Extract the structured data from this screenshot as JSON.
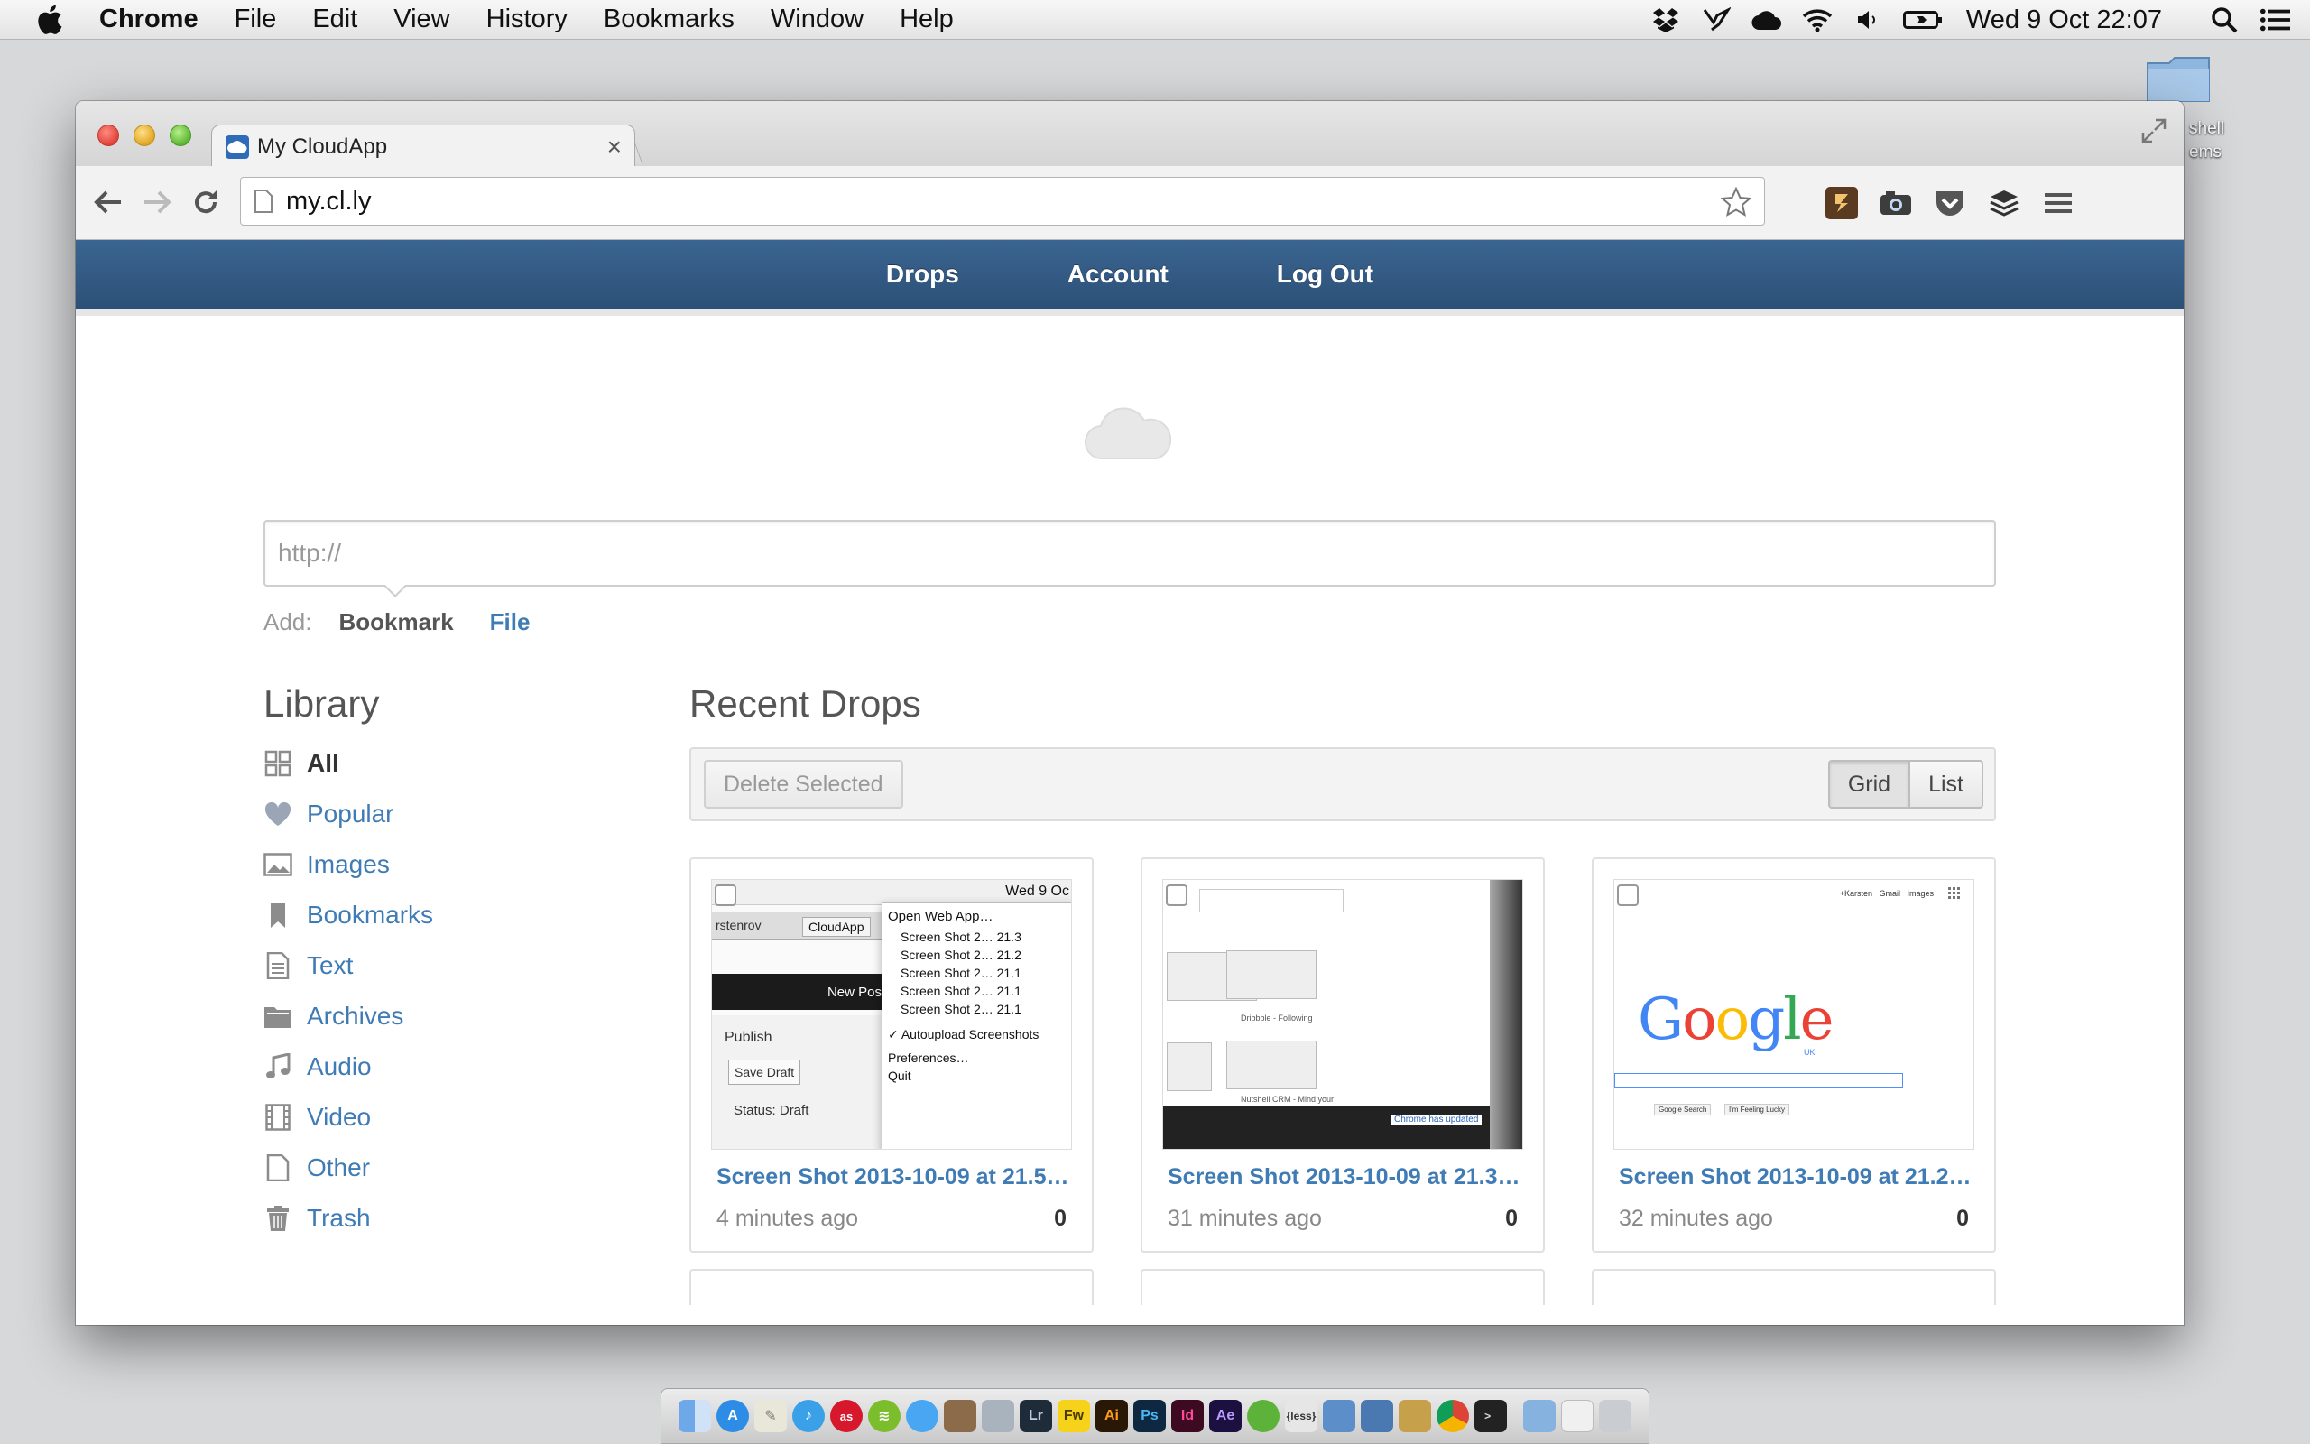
{
  "menubar": {
    "app_name": "Chrome",
    "items": [
      "File",
      "Edit",
      "View",
      "History",
      "Bookmarks",
      "Window",
      "Help"
    ],
    "clock": "Wed 9 Oct  22:07",
    "status_icons": [
      "dropbox-icon",
      "crane-icon",
      "cloud-icon",
      "wifi-icon",
      "volume-icon",
      "battery-icon",
      "spotlight-icon",
      "notification-center-icon"
    ]
  },
  "desktop": {
    "folder_label_line1": "shell",
    "folder_label_line2": "ems"
  },
  "browser": {
    "tab_title": "My CloudApp",
    "url": "my.cl.ly",
    "extensions": [
      "zootool-icon",
      "camera-icon",
      "pocket-icon",
      "buffer-icon",
      "menu-icon"
    ]
  },
  "site_nav": {
    "drops": "Drops",
    "account": "Account",
    "logout": "Log Out"
  },
  "add_form": {
    "placeholder": "http://",
    "add_label": "Add:",
    "bookmark_label": "Bookmark",
    "file_label": "File"
  },
  "library": {
    "title": "Library",
    "items": [
      {
        "label": "All",
        "icon": "grid-icon",
        "active": true
      },
      {
        "label": "Popular",
        "icon": "heart-icon"
      },
      {
        "label": "Images",
        "icon": "image-icon"
      },
      {
        "label": "Bookmarks",
        "icon": "bookmark-icon"
      },
      {
        "label": "Text",
        "icon": "text-file-icon"
      },
      {
        "label": "Archives",
        "icon": "archive-icon"
      },
      {
        "label": "Audio",
        "icon": "music-note-icon"
      },
      {
        "label": "Video",
        "icon": "film-icon"
      },
      {
        "label": "Other",
        "icon": "blank-file-icon"
      },
      {
        "label": "Trash",
        "icon": "trash-icon"
      }
    ]
  },
  "drops": {
    "title": "Recent Drops",
    "delete_label": "Delete Selected",
    "grid_label": "Grid",
    "list_label": "List",
    "items": [
      {
        "name": "Screen Shot 2013-10-09 at 21.5…",
        "time": "4 minutes ago",
        "views": "0"
      },
      {
        "name": "Screen Shot 2013-10-09 at 21.3…",
        "time": "31 minutes ago",
        "views": "0"
      },
      {
        "name": "Screen Shot 2013-10-09 at 21.2…",
        "time": "32 minutes ago",
        "views": "0"
      }
    ],
    "thumb1": {
      "status_date": "Wed 9 Oc",
      "tab_label": "CloudApp",
      "tab_prefix": "rstenrov",
      "new_post": "New Pos",
      "publish": "Publish",
      "save_draft": "Save Draft",
      "status_draft": "Status: Draft",
      "menu": [
        "Open Web App…",
        "Screen Shot 2… 21.3",
        "Screen Shot 2… 21.2",
        "Screen Shot 2… 21.1",
        "Screen Shot 2… 21.1",
        "Screen Shot 2… 21.1",
        "✓ Autoupload Screenshots",
        "Preferences…",
        "Quit"
      ]
    },
    "thumb2": {
      "caption1": "Dribbble - Following",
      "caption2": "Nutshell CRM - Mind your",
      "caption3": "Chrome has updated"
    },
    "thumb3": {
      "logo": "Google",
      "logo_sub": "UK",
      "top_links": "+Karsten   Gmail   Images",
      "search_btn": "Google Search",
      "lucky_btn": "I'm Feeling Lucky"
    }
  },
  "dock": {
    "icons": [
      "finder-icon",
      "app-store-icon",
      "preview-icon",
      "itunes-icon",
      "lastfm-icon",
      "spotify-icon",
      "messages-icon",
      "photo-icon",
      "iphoto-icon",
      "lightroom-icon",
      "fireworks-icon",
      "illustrator-icon",
      "photoshop-icon",
      "indesign-icon",
      "after-effects-icon",
      "leaf-icon",
      "less-icon",
      "xcode-icon",
      "script-icon",
      "beer-icon",
      "chrome-icon",
      "terminal-icon",
      "folder-icon",
      "mail-icon",
      "trash-icon"
    ],
    "labels": {
      "lr": "Lr",
      "fw": "Fw",
      "ai": "Ai",
      "ps": "Ps",
      "id": "Id",
      "ae": "Ae",
      "less": "{less}"
    }
  },
  "colors": {
    "nav_bg": "#2f5a85",
    "link_blue": "#3f7bb5",
    "muted_gray": "#999999"
  }
}
